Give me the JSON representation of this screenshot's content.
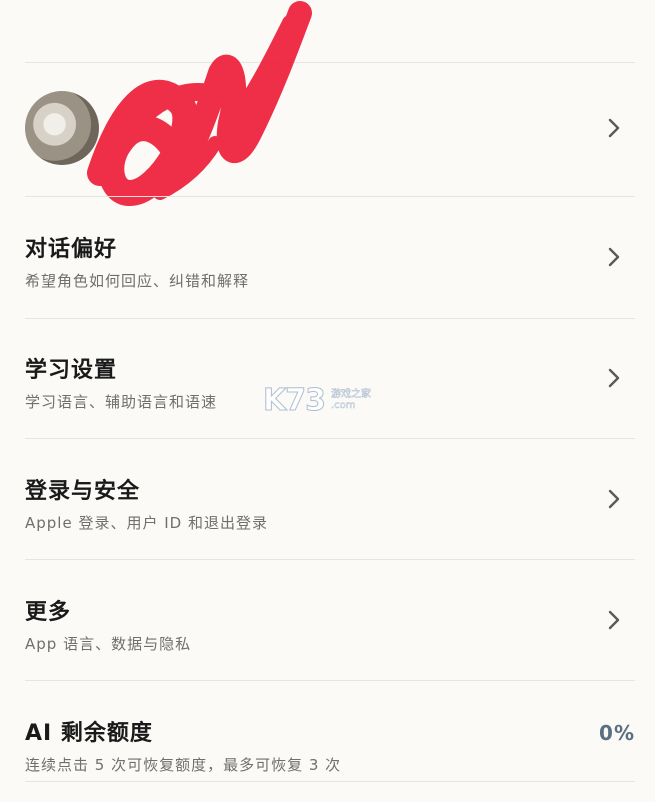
{
  "profile": {
    "avatar": "avatar-image"
  },
  "settings": {
    "items": [
      {
        "title": "对话偏好",
        "subtitle": "希望角色如何回应、纠错和解释"
      },
      {
        "title": "学习设置",
        "subtitle": "学习语言、辅助语言和语速"
      },
      {
        "title": "登录与安全",
        "subtitle": "Apple 登录、用户 ID 和退出登录"
      },
      {
        "title": "更多",
        "subtitle": "App 语言、数据与隐私"
      }
    ],
    "credits": {
      "title": "AI 剩余额度",
      "subtitle": "连续点击 5 次可恢复额度，最多可恢复 3 次",
      "value": "0%"
    }
  },
  "watermark": {
    "main": "K73",
    "line1": "游戏之家",
    "line2": ".com"
  },
  "icons": {
    "chevron": "chevron-right-icon"
  },
  "colors": {
    "background": "#fbfaf7",
    "divider": "#e7e5e0",
    "subtitle": "#6f6f6f",
    "chevron": "#5a5a5a",
    "accent_value": "#5b6f82",
    "scribble": "#ee1d3a"
  }
}
